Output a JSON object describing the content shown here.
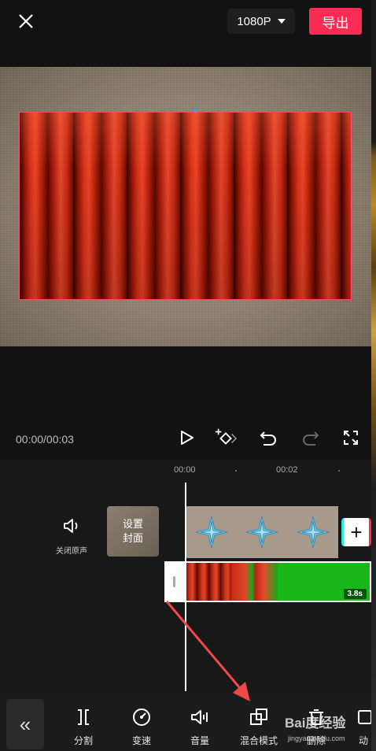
{
  "top_bar": {
    "resolution": "1080P",
    "export_label": "导出"
  },
  "playback": {
    "timecode": "00:00/00:03"
  },
  "ruler": {
    "labels": [
      "00:00",
      "00:02"
    ]
  },
  "timeline": {
    "mute_label": "关闭原声",
    "cover_label_line1": "设置",
    "cover_label_line2": "封面",
    "clip_duration": "3.8s",
    "add_clip_symbol": "+"
  },
  "toolbar": {
    "collapse_symbol": "«",
    "items": [
      {
        "label": "分割",
        "icon": "split-icon"
      },
      {
        "label": "变速",
        "icon": "speed-icon"
      },
      {
        "label": "音量",
        "icon": "volume-icon"
      },
      {
        "label": "混合模式",
        "icon": "blend-mode-icon"
      },
      {
        "label": "删除",
        "icon": "delete-icon"
      },
      {
        "label": "动",
        "icon": "animation-icon"
      }
    ]
  },
  "watermark": {
    "text": "Bai度经验",
    "url": "jingyan.baidu.com"
  },
  "colors": {
    "accent": "#fe2c55",
    "selection_border": "#ff4a6a",
    "arrow": "#f0484a"
  }
}
